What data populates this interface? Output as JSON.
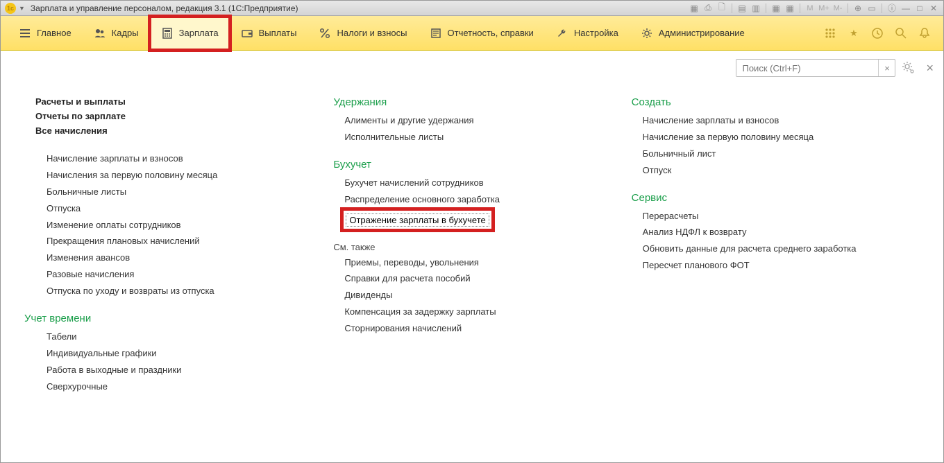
{
  "title": "Зарплата и управление персоналом, редакция 3.1  (1С:Предприятие)",
  "topmenu": {
    "main": "Главное",
    "kadry": "Кадры",
    "zarplata": "Зарплата",
    "vyplaty": "Выплаты",
    "nalogi": "Налоги и взносы",
    "otchet": "Отчетность, справки",
    "nastr": "Настройка",
    "admin": "Администрирование"
  },
  "search": {
    "placeholder": "Поиск (Ctrl+F)"
  },
  "col1": {
    "b1": "Расчеты и выплаты",
    "b2": "Отчеты по зарплате",
    "b3": "Все начисления",
    "i1": "Начисление зарплаты и взносов",
    "i2": "Начисления за первую половину месяца",
    "i3": "Больничные листы",
    "i4": "Отпуска",
    "i5": "Изменение оплаты сотрудников",
    "i6": "Прекращения плановых начислений",
    "i7": "Изменения авансов",
    "i8": "Разовые начисления",
    "i9": "Отпуска по уходу и возвраты из отпуска",
    "g2": "Учет времени",
    "t1": "Табели",
    "t2": "Индивидуальные графики",
    "t3": "Работа в выходные и праздники",
    "t4": "Сверхурочные"
  },
  "col2": {
    "g1": "Удержания",
    "u1": "Алименты и другие удержания",
    "u2": "Исполнительные листы",
    "g2": "Бухучет",
    "a1": "Бухучет начислений сотрудников",
    "a2": "Распределение основного заработка",
    "a3": "Отражение зарплаты в бухучете",
    "g3": "См. также",
    "s1": "Приемы, переводы, увольнения",
    "s2": "Справки для расчета пособий",
    "s3": "Дивиденды",
    "s4": "Компенсация за задержку зарплаты",
    "s5": "Сторнирования начислений"
  },
  "col3": {
    "g1": "Создать",
    "c1": "Начисление зарплаты и взносов",
    "c2": "Начисление за первую половину месяца",
    "c3": "Больничный лист",
    "c4": "Отпуск",
    "g2": "Сервис",
    "v1": "Перерасчеты",
    "v2": "Анализ НДФЛ к возврату",
    "v3": "Обновить данные для расчета среднего заработка",
    "v4": "Пересчет планового ФОТ"
  }
}
